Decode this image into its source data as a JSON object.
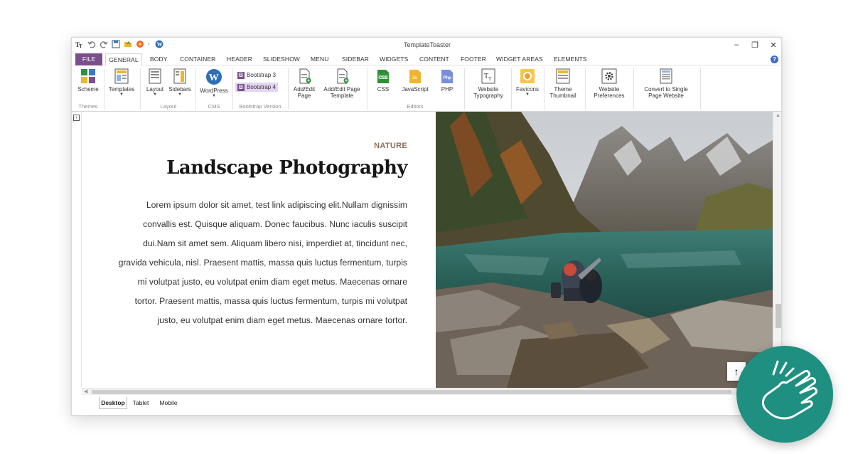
{
  "window": {
    "title": "TemplateToaster",
    "qat_icons": [
      "app-logo-icon",
      "undo-icon",
      "redo-icon",
      "save-icon",
      "open-folder-icon",
      "browser-preview-icon",
      "wordpress-icon"
    ]
  },
  "tabs": [
    "FILE",
    "GENERAL",
    "BODY",
    "CONTAINER",
    "HEADER",
    "SLIDESHOW",
    "MENU",
    "SIDEBAR",
    "WIDGETS",
    "CONTENT",
    "FOOTER",
    "WIDGET AREAS",
    "ELEMENTS"
  ],
  "active_tab": "GENERAL",
  "ribbon": {
    "scheme": "Scheme",
    "templates": "Templates",
    "layout": "Layout",
    "sidebars": "Sidebars",
    "wordpress": "WordPress",
    "bootstrap3": "Bootstrap 3",
    "bootstrap4": "Bootstrap 4",
    "add_edit_page": [
      "Add/Edit",
      "Page"
    ],
    "add_edit_page_template": [
      "Add/Edit Page",
      "Template"
    ],
    "css": "CSS",
    "javascript": "JavaScript",
    "php": "PHP",
    "website_typography": [
      "Website",
      "Typography"
    ],
    "favicons": "Favicons",
    "theme_thumbnail": [
      "Theme",
      "Thumbnail"
    ],
    "website_preferences": [
      "Website",
      "Preferences"
    ],
    "convert_single_page": [
      "Convert to Single",
      "Page Website"
    ],
    "groups": {
      "themes": "Themes",
      "layout": "Layout",
      "cms": "CMS",
      "bootstrap_version": "Bootstrap Version",
      "editors": "Editors"
    }
  },
  "content": {
    "category": "NATURE",
    "heading": "Landscape Photography",
    "lines": [
      "Lorem ipsum dolor sit amet, test link adipiscing elit.Nullam dignissim",
      "convallis est. Quisque aliquam. Donec faucibus. Nunc iaculis suscipit",
      "dui.Nam sit amet sem. Aliquam libero nisi, imperdiet at, tincidunt nec,",
      "gravida vehicula, nisl. Praesent mattis, massa quis luctus fermentum, turpis",
      "mi volutpat justo, eu volutpat enim diam eget metus. Maecenas ornare",
      "tortor. Praesent mattis, massa quis luctus fermentum, turpis mi volutpat",
      "justo, eu volutpat enim diam eget metus. Maecenas ornare tortor."
    ]
  },
  "device_tabs": {
    "desktop": "Desktop",
    "tablet": "Tablet",
    "mobile": "Mobile",
    "active": "Desktop"
  },
  "colors": {
    "file_tab": "#7b4f8e",
    "bootstrap_active": "#e4d3f2",
    "category_text": "#8b6f5c",
    "badge": "#1e8f80"
  }
}
